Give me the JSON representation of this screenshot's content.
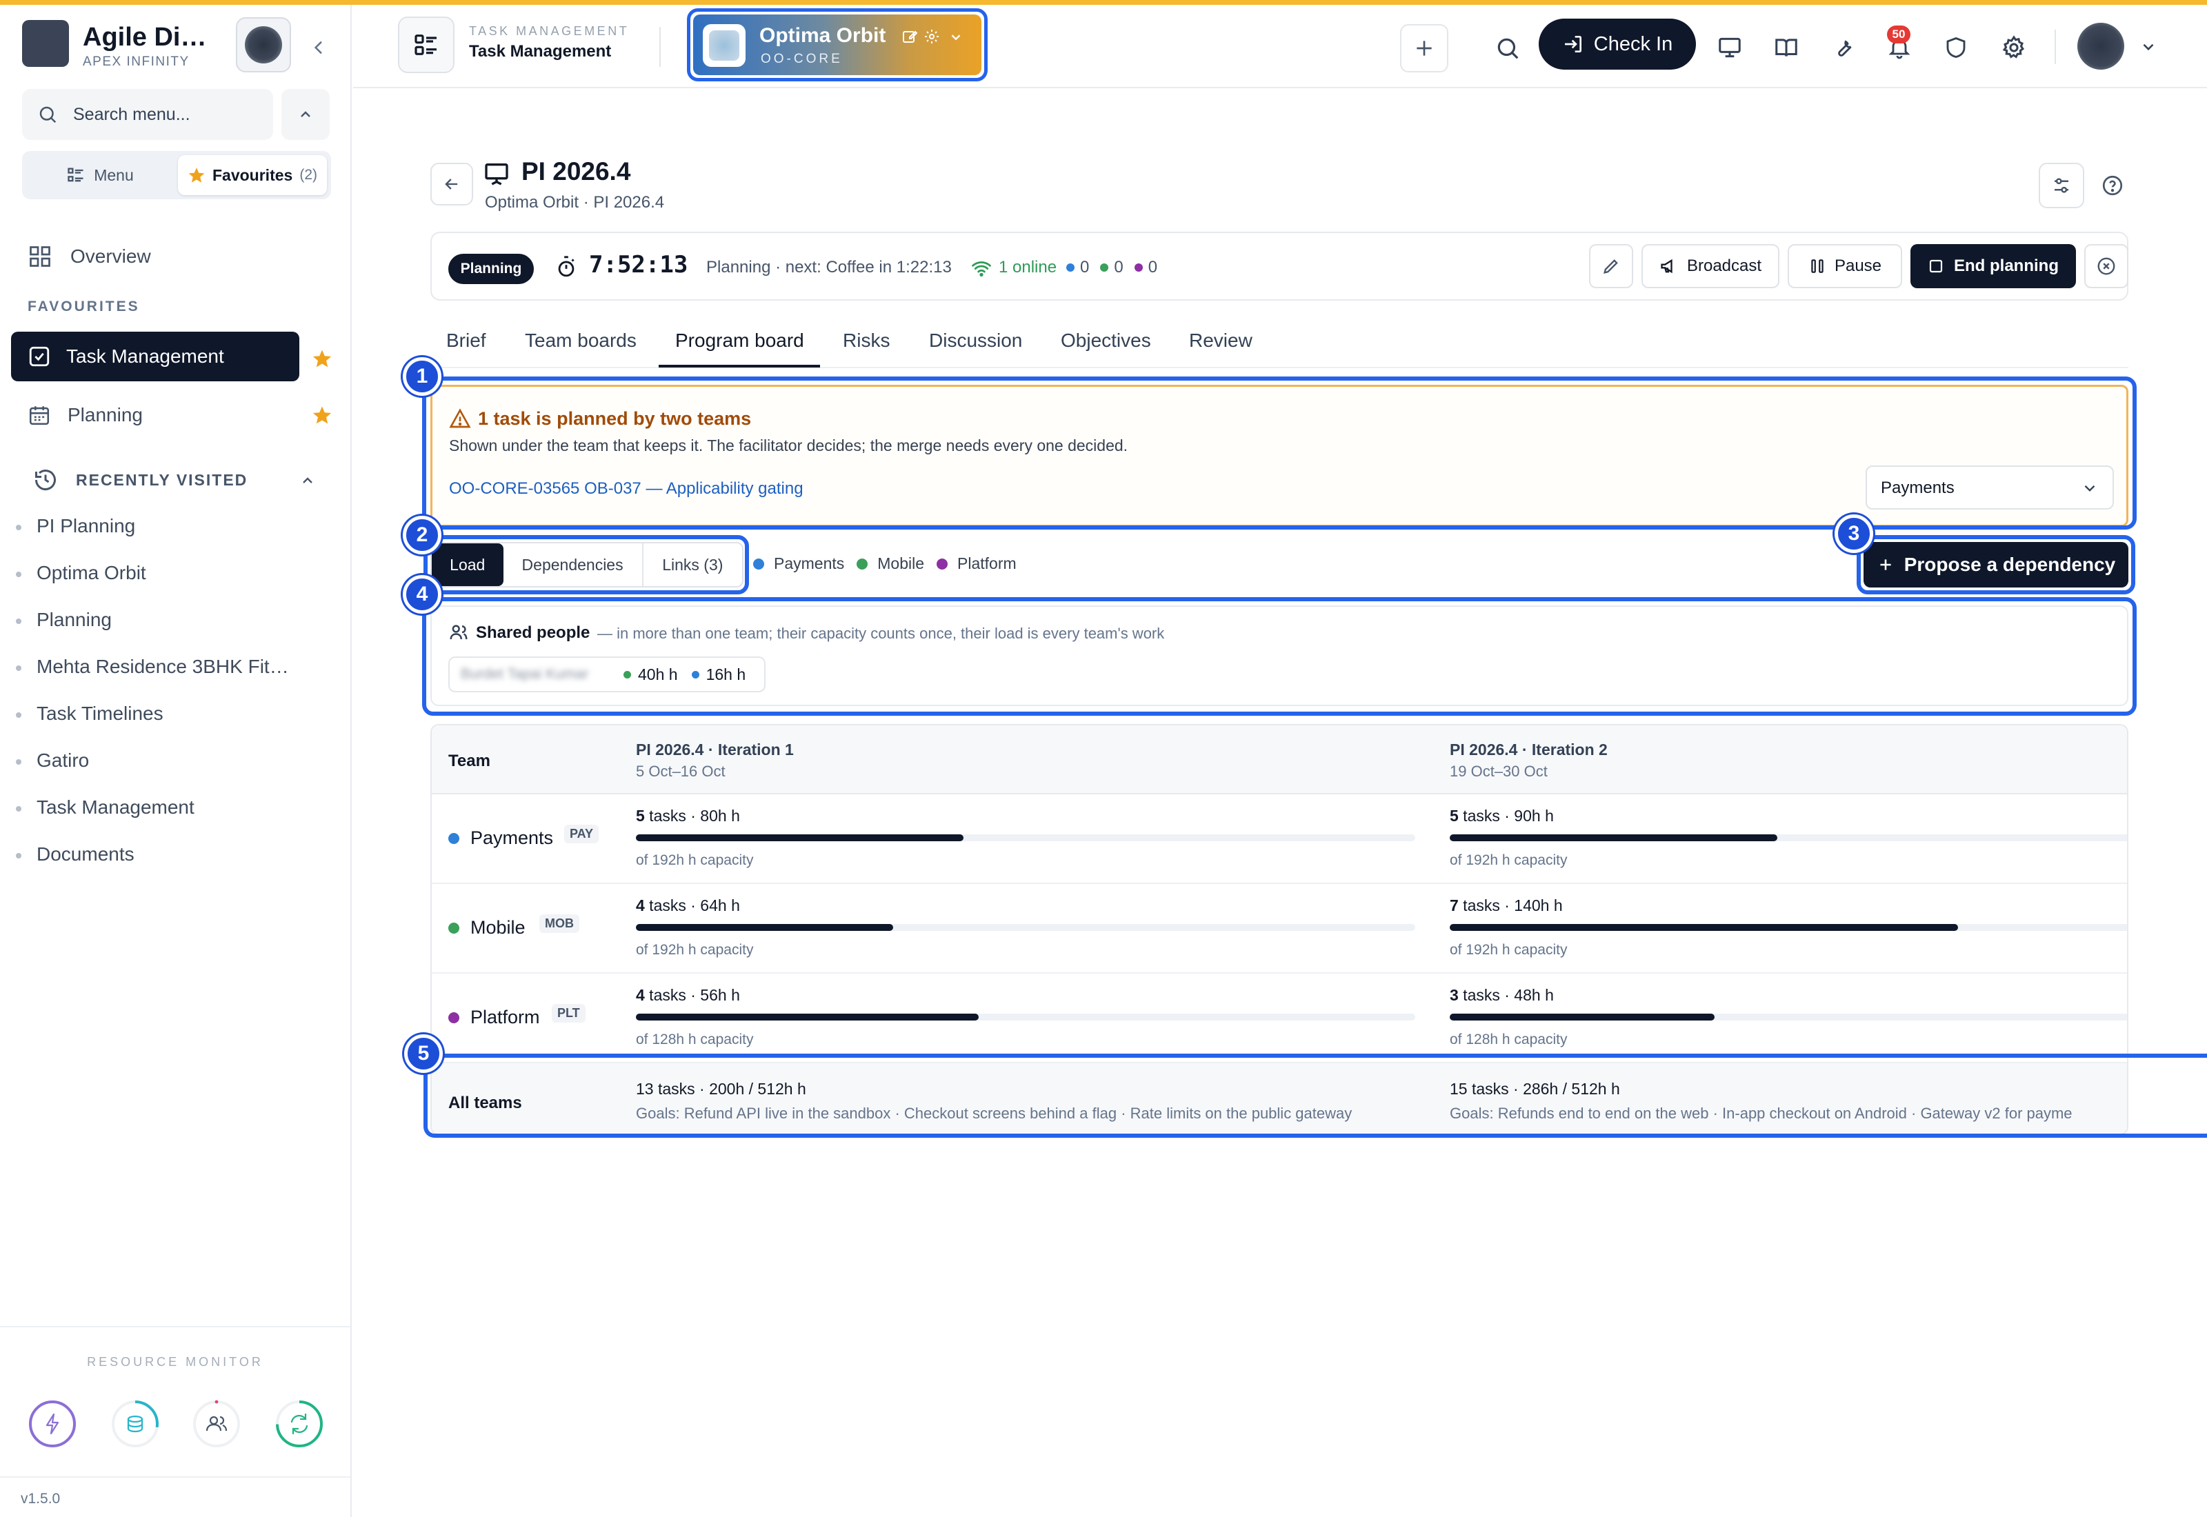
{
  "app": {
    "name": "Agile Di…",
    "org": "APEX INFINITY",
    "version": "v1.5.0"
  },
  "sidebar": {
    "search_placeholder": "Search menu...",
    "menu_tab": "Menu",
    "favourites_tab": "Favourites",
    "favourites_count": "(2)",
    "overview": "Overview",
    "favourites_heading": "FAVOURITES",
    "favourites": [
      {
        "label": "Task Management",
        "active": true
      },
      {
        "label": "Planning",
        "active": false
      }
    ],
    "recent_heading": "RECENTLY VISITED",
    "recent": [
      "PI Planning",
      "Optima Orbit",
      "Planning",
      "Mehta Residence 3BHK Fit…",
      "Task Timelines",
      "Gatiro",
      "Task Management",
      "Documents"
    ],
    "resource_monitor": "RESOURCE MONITOR"
  },
  "header": {
    "section_label": "TASK MANAGEMENT",
    "section_title": "Task Management",
    "project_name": "Optima Orbit",
    "project_code": "OO-CORE",
    "check_in": "Check In",
    "notification_count": "50"
  },
  "page": {
    "title": "PI 2026.4",
    "breadcrumb": "Optima Orbit · PI 2026.4",
    "status": "Planning",
    "timer": "7:52:13",
    "timer_note": "Planning · next: Coffee in 1:22:13",
    "online": "1 online",
    "counts": [
      "0",
      "0",
      "0"
    ],
    "buttons": {
      "broadcast": "Broadcast",
      "pause": "Pause",
      "end": "End planning"
    }
  },
  "tabs": [
    "Brief",
    "Team boards",
    "Program board",
    "Risks",
    "Discussion",
    "Objectives",
    "Review"
  ],
  "active_tab": "Program board",
  "alert": {
    "title": "1 task is planned by two teams",
    "text": "Shown under the team that keeps it. The facilitator decides; the merge needs every one decided.",
    "link": "OO-CORE-03565 OB-037 — Applicability gating",
    "select_value": "Payments"
  },
  "view_toggle": {
    "options": [
      "Load",
      "Dependencies",
      "Links (3)"
    ],
    "active": "Load"
  },
  "legend": [
    {
      "name": "Payments",
      "color": "#2f80d8"
    },
    {
      "name": "Mobile",
      "color": "#3aa05a"
    },
    {
      "name": "Platform",
      "color": "#8e2fa3"
    }
  ],
  "propose_button": "Propose a dependency",
  "shared": {
    "title": "Shared people",
    "subtitle": "— in more than one team; their capacity counts once, their load is every team's work",
    "person": "Burdet Tapai Kumar",
    "hours": [
      "40h h",
      "16h h"
    ]
  },
  "table": {
    "team_header": "Team",
    "iterations": [
      {
        "name": "PI 2026.4 · Iteration 1",
        "dates": "5 Oct–16 Oct"
      },
      {
        "name": "PI 2026.4 · Iteration 2",
        "dates": "19 Oct–30 Oct"
      }
    ],
    "rows": [
      {
        "team": "Payments",
        "code": "PAY",
        "color": "#2f80d8",
        "cells": [
          {
            "count": "5",
            "hours": " tasks · 80h h",
            "capacity": "of 192h h capacity",
            "load": 0.42
          },
          {
            "count": "5",
            "hours": " tasks · 90h h",
            "capacity": "of 192h h capacity",
            "load": 0.47
          }
        ]
      },
      {
        "team": "Mobile",
        "code": "MOB",
        "color": "#3aa05a",
        "cells": [
          {
            "count": "4",
            "hours": " tasks · 64h h",
            "capacity": "of 192h h capacity",
            "load": 0.33
          },
          {
            "count": "7",
            "hours": " tasks · 140h h",
            "capacity": "of 192h h capacity",
            "load": 0.73
          }
        ]
      },
      {
        "team": "Platform",
        "code": "PLT",
        "color": "#8e2fa3",
        "cells": [
          {
            "count": "4",
            "hours": " tasks · 56h h",
            "capacity": "of 128h h capacity",
            "load": 0.44
          },
          {
            "count": "3",
            "hours": " tasks · 48h h",
            "capacity": "of 128h h capacity",
            "load": 0.38
          }
        ]
      }
    ],
    "totals_label": "All teams",
    "totals": [
      {
        "summary": "13 tasks · 200h / 512h h",
        "goals": "Goals: Refund API live in the sandbox · Checkout screens behind a flag · Rate limits on the public gateway"
      },
      {
        "summary": "15 tasks · 286h / 512h h",
        "goals": "Goals: Refunds end to end on the web · In-app checkout on Android · Gateway v2 for payme"
      }
    ]
  },
  "annotations": [
    "1",
    "2",
    "3",
    "4",
    "5"
  ]
}
